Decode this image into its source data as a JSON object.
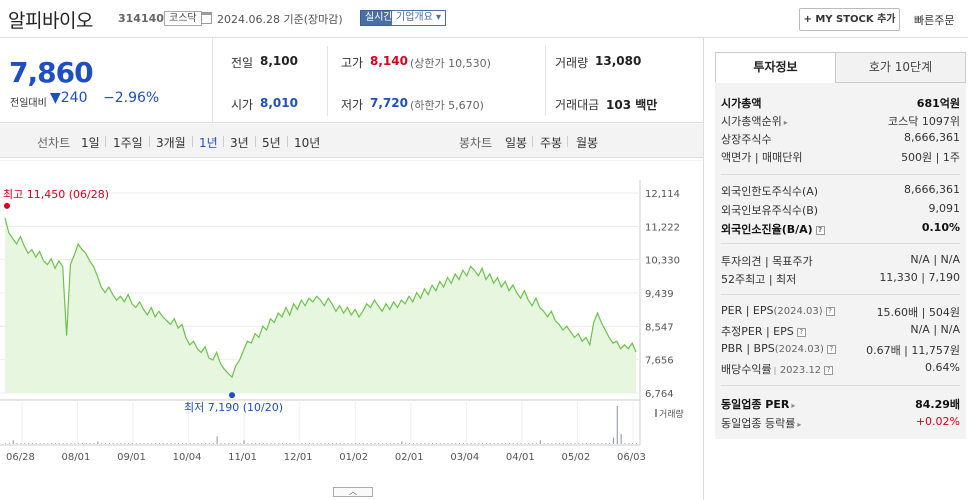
{
  "header": {
    "stock_name": "알피바이오",
    "stock_code": "314140",
    "market": "코스닥",
    "as_of": "2024.06.28  기준(장마감)",
    "realtime": "실시간",
    "company_overview": "기업개요 ▾",
    "mystock": "+ MY STOCK 추가",
    "quick_order": "빠른주문"
  },
  "quote": {
    "price": "7,860",
    "change_label": "전일대비",
    "change_value": "▼240",
    "change_pct": "−2.96%",
    "prev_label": "전일",
    "prev": "8,100",
    "high_label": "고가",
    "high": "8,140",
    "upper_limit": "(상한가 10,530)",
    "volume_label": "거래량",
    "volume": "13,080",
    "open_label": "시가",
    "open": "8,010",
    "low_label": "저가",
    "low": "7,720",
    "lower_limit": "(하한가 5,670)",
    "amount_label": "거래대금",
    "amount": "103 백만"
  },
  "period_bar": {
    "line_label": "선차트",
    "line_periods": [
      "1일",
      "1주일",
      "3개월",
      "1년",
      "3년",
      "5년",
      "10년"
    ],
    "candle_label": "봉차트",
    "candle_periods": [
      "일봉",
      "주봉",
      "월봉"
    ]
  },
  "chart_data": {
    "type": "area",
    "title": "",
    "y_ticks": [
      "12,114",
      "11,222",
      "10,330",
      "9,439",
      "8,547",
      "7,656",
      "6,764"
    ],
    "ylim": [
      6764,
      12114
    ],
    "x_ticks": [
      "06/28",
      "08/01",
      "09/01",
      "10/04",
      "11/01",
      "12/01",
      "01/02",
      "02/01",
      "03/04",
      "04/01",
      "05/02",
      "06/03"
    ],
    "high_label": "최고 11,450 (06/28)",
    "low_label": "최저 7,190 (10/20)",
    "volume_label": "거래량",
    "prices": [
      11450,
      11050,
      10900,
      10750,
      10950,
      10700,
      10500,
      10600,
      10400,
      10550,
      10300,
      10200,
      10350,
      10100,
      10300,
      10150,
      8300,
      10200,
      10450,
      10750,
      10600,
      10500,
      10300,
      10150,
      9900,
      9600,
      9450,
      9600,
      9400,
      9250,
      9350,
      9200,
      9400,
      9150,
      9050,
      9200,
      9000,
      8850,
      9050,
      8800,
      8950,
      8800,
      8700,
      8600,
      8750,
      8500,
      8600,
      8250,
      8050,
      8150,
      7950,
      7850,
      8000,
      7700,
      7650,
      7850,
      7550,
      7400,
      7290,
      7190,
      7500,
      7650,
      7900,
      8150,
      8100,
      8350,
      8250,
      8550,
      8450,
      8750,
      8650,
      8900,
      8800,
      9050,
      8850,
      9150,
      9000,
      9250,
      9100,
      9300,
      9200,
      9350,
      9250,
      9100,
      9300,
      9150,
      8950,
      9100,
      8900,
      9050,
      8850,
      9000,
      8800,
      8950,
      9150,
      9050,
      9250,
      9100,
      8950,
      9150,
      9000,
      9200,
      9050,
      9250,
      9150,
      9350,
      9200,
      9450,
      9300,
      9550,
      9400,
      9650,
      9500,
      9750,
      9600,
      9850,
      9700,
      9950,
      9800,
      10050,
      9900,
      10150,
      10050,
      9900,
      10100,
      9800,
      9950,
      9700,
      9850,
      9600,
      9750,
      9500,
      9650,
      9450,
      9300,
      9500,
      9250,
      9100,
      9300,
      9050,
      8950,
      8800,
      8950,
      8700,
      8600,
      8450,
      8550,
      8400,
      8250,
      8350,
      8150,
      8250,
      8050,
      8650,
      8900,
      8650,
      8450,
      8250,
      8100,
      8150,
      7950,
      8050,
      7950,
      8100,
      7860
    ],
    "volume_spikes": [
      {
        "i": 2,
        "v": 3
      },
      {
        "i": 24,
        "v": 2
      },
      {
        "i": 55,
        "v": 6
      },
      {
        "i": 62,
        "v": 3
      },
      {
        "i": 103,
        "v": 2
      },
      {
        "i": 139,
        "v": 3
      },
      {
        "i": 158,
        "v": 5
      },
      {
        "i": 159,
        "v": 30
      },
      {
        "i": 160,
        "v": 8
      }
    ]
  },
  "right_panel": {
    "tab_info": "투자정보",
    "tab_order": "호가 10단계",
    "rows": {
      "market_cap_label": "시가총액",
      "market_cap": "681억원",
      "rank_label": "시가총액순위",
      "rank": "코스닥 1097위",
      "shares_label": "상장주식수",
      "shares": "8,666,361",
      "par_label": "액면가 | 매매단위",
      "par": "500원 | 1주",
      "foreign_limit_label": "외국인한도주식수(A)",
      "foreign_limit": "8,666,361",
      "foreign_hold_label": "외국인보유주식수(B)",
      "foreign_hold": "9,091",
      "foreign_rate_label": "외국인소진율(B/A)",
      "foreign_rate": "0.10%",
      "opinion_label": "투자의견 | 목표주가",
      "opinion": "N/A | N/A",
      "w52_label": "52주최고 | 최저",
      "w52": "11,330 | 7,190",
      "per_label": "PER | EPS",
      "per_year": "(2024.03)",
      "per": "15.60배 | 504원",
      "est_per_label": "추정PER | EPS",
      "est_per": "N/A | N/A",
      "pbr_label": "PBR | BPS",
      "pbr_year": "(2024.03)",
      "pbr": "0.67배 | 11,757원",
      "div_label": "배당수익률",
      "div_year": "2023.12",
      "div": "0.64%",
      "ind_per_label": "동일업종 PER",
      "ind_per": "84.29배",
      "ind_rate_label": "동일업종 등락률",
      "ind_rate": "+0.02%"
    }
  },
  "colors": {
    "up": "#d9001b",
    "down": "#1e4fc2",
    "line": "#6cc24a",
    "fill": "#e6f6df"
  }
}
